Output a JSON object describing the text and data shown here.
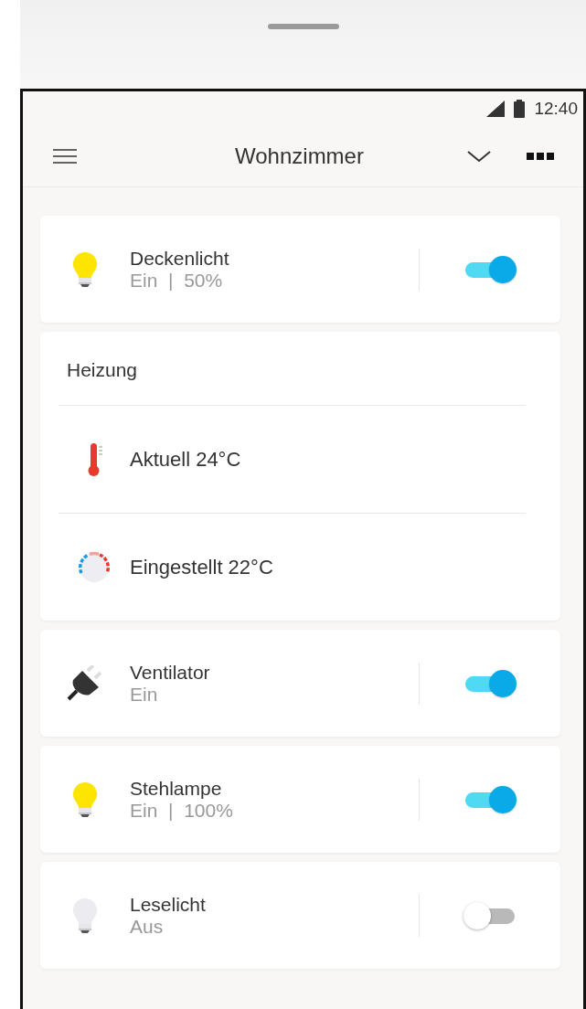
{
  "status_bar": {
    "time": "12:40"
  },
  "header": {
    "title": "Wohnzimmer"
  },
  "cards": [
    {
      "kind": "light",
      "name": "Deckenlicht",
      "status": "Ein  |  50%",
      "on": true
    },
    {
      "kind": "heating",
      "title": "Heizung",
      "rows": [
        {
          "kind": "thermometer",
          "text": "Aktuell 24°C"
        },
        {
          "kind": "dial",
          "text": "Eingestellt 22°C"
        }
      ]
    },
    {
      "kind": "plug",
      "name": "Ventilator",
      "status": "Ein",
      "on": true
    },
    {
      "kind": "light",
      "name": "Stehlampe",
      "status": "Ein  |  100%",
      "on": true
    },
    {
      "kind": "light",
      "name": "Leselicht",
      "status": "Aus",
      "on": false
    }
  ]
}
